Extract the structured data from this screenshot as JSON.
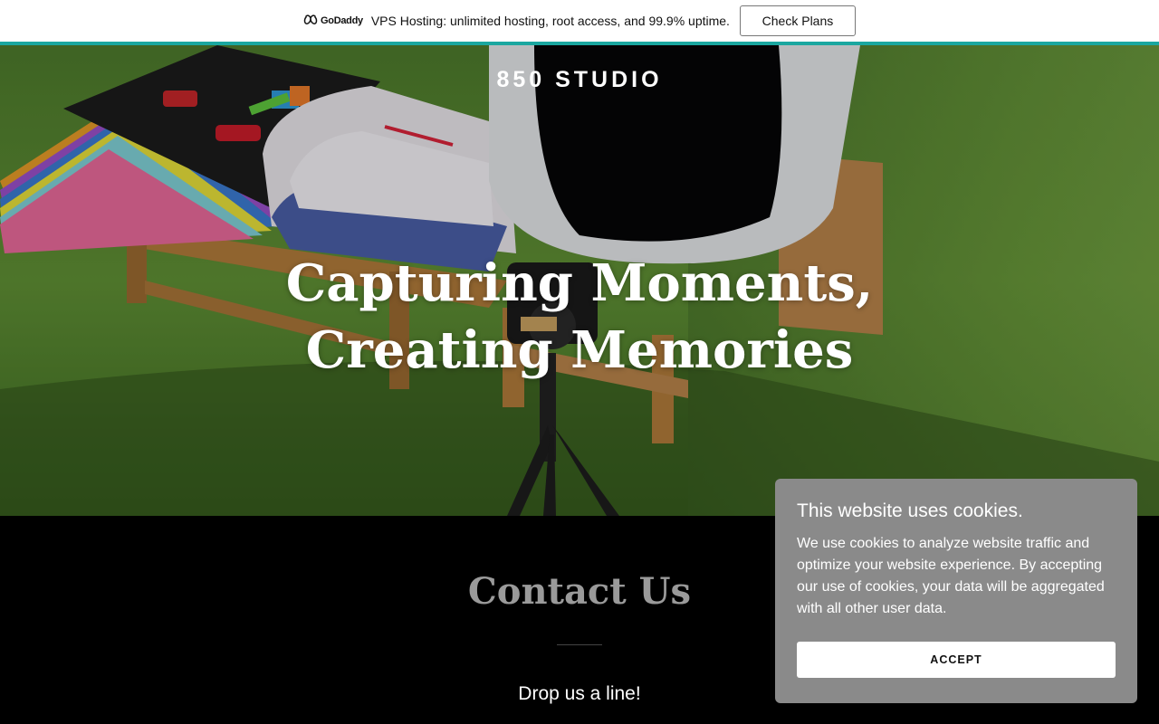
{
  "promo": {
    "brand": "GoDaddy",
    "brand_icon": "godaddy-logo-icon",
    "text": "VPS Hosting: unlimited hosting, root access, and 99.9% uptime.",
    "button_label": "Check Plans",
    "accent_color": "#1aa7a0"
  },
  "hero": {
    "site_title": "850 STUDIO",
    "headline_line1": "Capturing Moments,",
    "headline_line2": "Creating Memories",
    "image": "outdoor-photo-studio-on-grass-with-camera-tripod"
  },
  "contact": {
    "title": "Contact Us",
    "subtitle": "Drop us a line!"
  },
  "cookie": {
    "title": "This website uses cookies.",
    "body": "We use cookies to analyze website traffic and optimize your website experience. By accepting our use of cookies, your data will be aggregated with all other user data.",
    "accept_label": "ACCEPT",
    "background_color": "#8a8a8a"
  }
}
